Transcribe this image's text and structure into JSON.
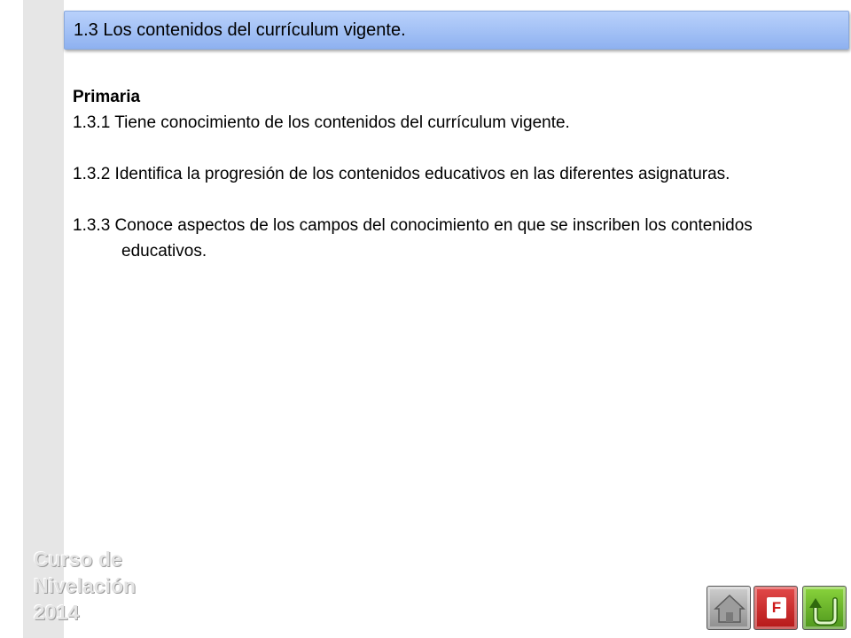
{
  "slide": {
    "title": "1.3 Los contenidos del currículum vigente."
  },
  "content": {
    "heading": "Primaria",
    "items": [
      "1.3.1 Tiene conocimiento de los contenidos del currículum vigente.",
      "1.3.2 Identifica la progresión de los contenidos educativos en las diferentes asignaturas.",
      "1.3.3 Conoce aspectos de los campos del conocimiento en que se inscriben los contenidos educativos."
    ]
  },
  "watermark": {
    "line1": "Curso de",
    "line2": "Nivelación",
    "line3": "2014"
  },
  "nav": {
    "home_icon": "home-icon",
    "f_label": "F",
    "back_icon": "u-turn-back-icon"
  },
  "colors": {
    "title_bar": "#a2c0f5",
    "left_band": "#e6e6e6",
    "home_button": "#a8a8a8",
    "f_button": "#cc2222",
    "back_button": "#6bb52c"
  }
}
